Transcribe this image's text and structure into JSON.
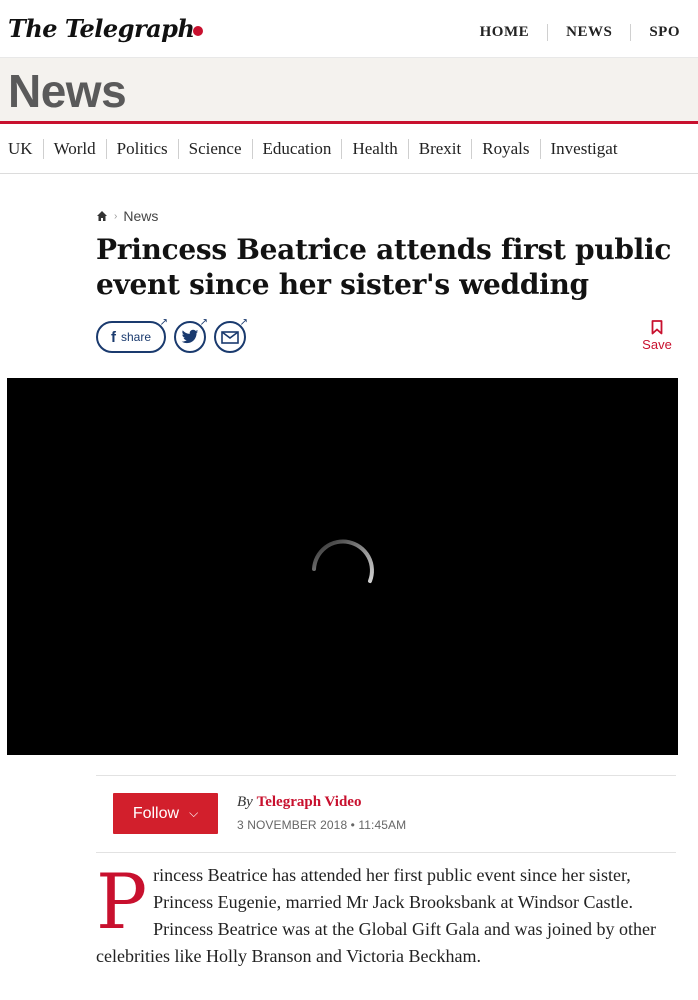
{
  "masthead": {
    "logo_text": "The Telegraph",
    "nav": [
      "HOME",
      "NEWS",
      "SPO"
    ]
  },
  "section": {
    "title": "News"
  },
  "sub_nav": [
    "UK",
    "World",
    "Politics",
    "Science",
    "Education",
    "Health",
    "Brexit",
    "Royals",
    "Investigat"
  ],
  "breadcrumb": {
    "label": "News"
  },
  "article": {
    "headline": "Princess Beatrice attends first public event since her sister's wedding",
    "share": {
      "facebook_label": "share",
      "save_label": "Save"
    },
    "video": {
      "state": "loading"
    },
    "follow_label": "Follow",
    "byline_prefix": "By",
    "author": "Telegraph Video",
    "date": "3 NOVEMBER 2018 • 11:45AM",
    "dropcap": "P",
    "body": "rincess Beatrice has attended her first public event since her sister, Princess Eugenie, married Mr Jack Brooksbank at Windsor Castle. Princess Beatrice was at the Global Gift Gala and was joined by other celebrities like Holly Branson and Victoria Beckham."
  },
  "colors": {
    "accent_red": "#c8102e",
    "follow_red": "#d21f2c",
    "share_navy": "#1a3a6e",
    "section_bg": "#f4f2ee"
  }
}
